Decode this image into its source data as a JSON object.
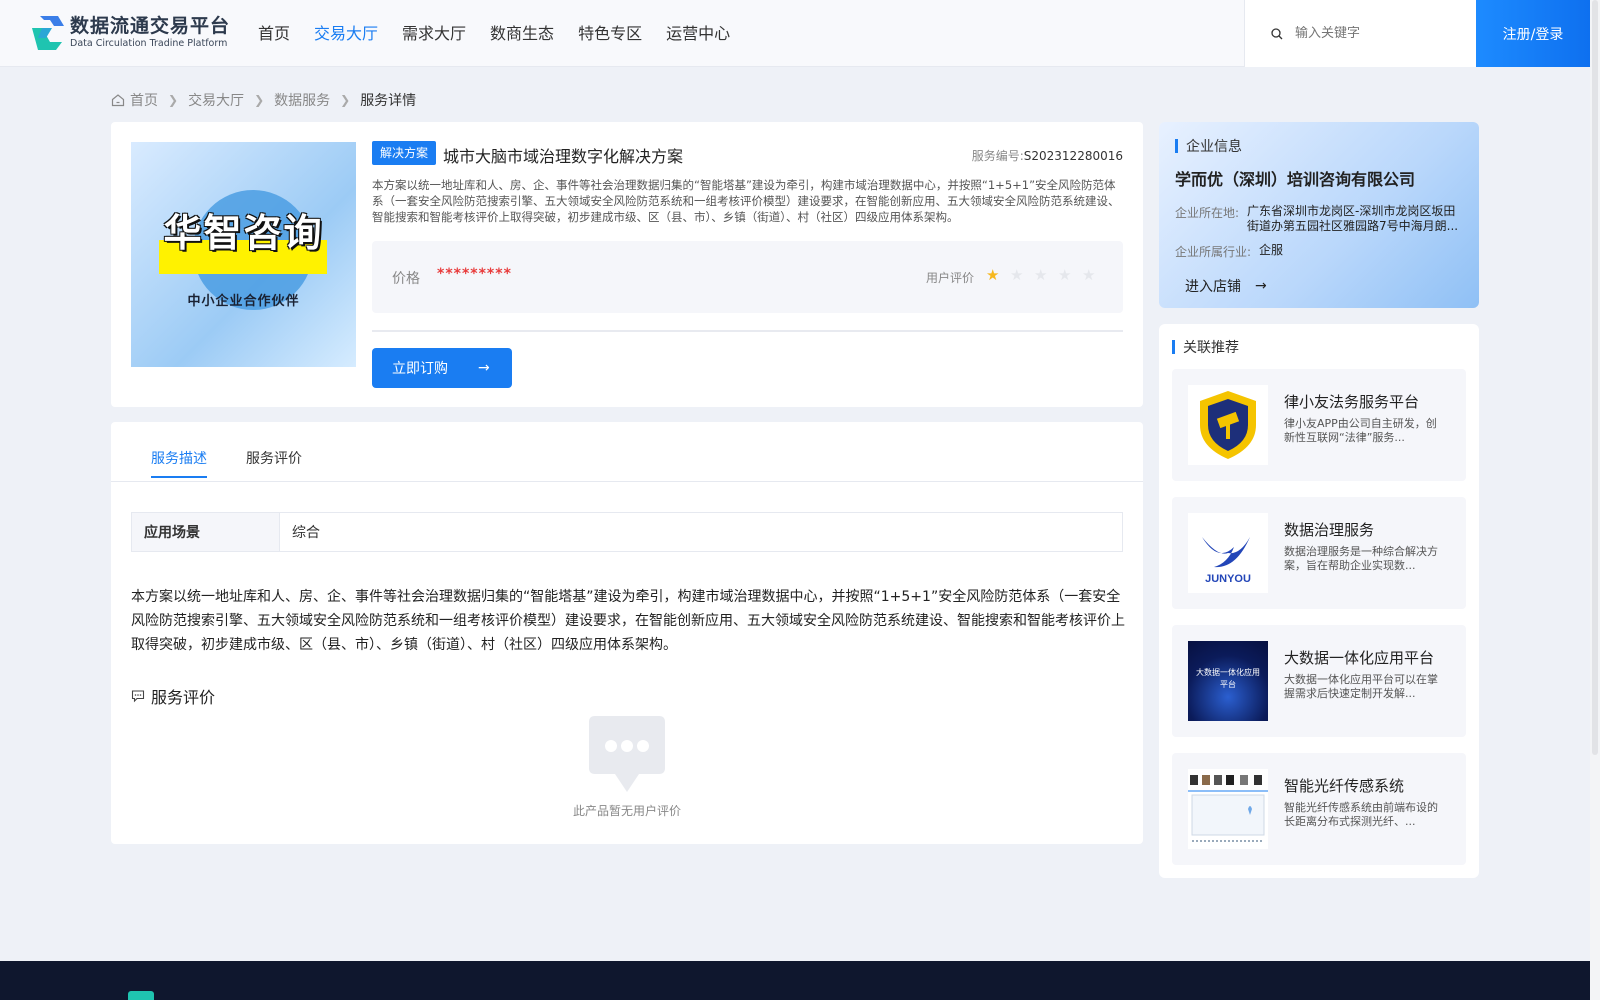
{
  "header": {
    "logo_cn": "数据流通交易平台",
    "logo_en": "Data Circulation Tradine Platform",
    "nav": [
      {
        "label": "首页"
      },
      {
        "label": "交易大厅"
      },
      {
        "label": "需求大厅"
      },
      {
        "label": "数商生态"
      },
      {
        "label": "特色专区"
      },
      {
        "label": "运营中心"
      }
    ],
    "active_nav": "交易大厅",
    "search_placeholder": "输入关键字",
    "login_label": "注册/登录"
  },
  "breadcrumb": [
    "首页",
    "交易大厅",
    "数据服务",
    "服务详情"
  ],
  "service": {
    "tag": "解决方案",
    "title": "城市大脑市域治理数字化解决方案",
    "no_label": "服务编号:",
    "no_value": "S202312280016",
    "summary": "本方案以统一地址库和人、房、企、事件等社会治理数据归集的“智能塔基”建设为牵引，构建市域治理数据中心，并按照“1+5+1”安全风险防范体系（一套安全风险防范搜索引擎、五大领域安全风险防范系统和一组考核评价模型）建设要求，在智能创新应用、五大领域安全风险防范系统建设、智能搜索和智能考核评价上取得突破，初步建成市级、区（县、市）、乡镇（街道）、村（社区）四级应用体系架构。",
    "price_label": "价格",
    "price_value": "*********",
    "rating_label": "用户评价",
    "rating": 1,
    "rating_max": 5,
    "buy_label": "立即订购",
    "cover_title": "华智咨询",
    "cover_sub": "中小企业合作伙伴"
  },
  "tabs": [
    {
      "label": "服务描述",
      "active": true
    },
    {
      "label": "服务评价",
      "active": false
    }
  ],
  "description": {
    "scene_key": "应用场景",
    "scene_value": "综合",
    "body": "本方案以统一地址库和人、房、企、事件等社会治理数据归集的“智能塔基”建设为牵引，构建市域治理数据中心，并按照“1+5+1”安全风险防范体系（一套安全风险防范搜索引擎、五大领域安全风险防范系统和一组考核评价模型）建设要求，在智能创新应用、五大领域安全风险防范系统建设、智能搜索和智能考核评价上取得突破，初步建成市级、区（县、市）、乡镇（街道）、村（社区）四级应用体系架构。",
    "eval_title": "服务评价",
    "empty_text": "此产品暂无用户评价"
  },
  "company": {
    "section_title": "企业信息",
    "name": "学而优（深圳）培训咨询有限公司",
    "addr_key": "企业所在地:",
    "addr_value": "广东省深圳市龙岗区-深圳市龙岗区坂田街道办第五园社区雅园路7号中海月朗...",
    "industry_key": "企业所属行业:",
    "industry_value": "企服",
    "enter_label": "进入店铺"
  },
  "recommend": {
    "section_title": "关联推荐",
    "items": [
      {
        "name": "律小友法务服务平台",
        "desc": "律小友APP由公司自主研发，创新性互联网“法律”服务..."
      },
      {
        "name": "数据治理服务",
        "desc": "数据治理服务是一种综合解决方案，旨在帮助企业实现数...",
        "logo_text": "JUNYOU"
      },
      {
        "name": "大数据一体化应用平台",
        "desc": "大数据一体化应用平台可以在掌握需求后快速定制开发解...",
        "thumb_text": "大数据一体化应用平台"
      },
      {
        "name": "智能光纤传感系统",
        "desc": "智能光纤传感系统由前端布设的长距离分布式探测光纤、..."
      }
    ]
  },
  "colors": {
    "accent": "#1a7df2",
    "price": "#e83b3b",
    "star": "#f6b81f"
  }
}
